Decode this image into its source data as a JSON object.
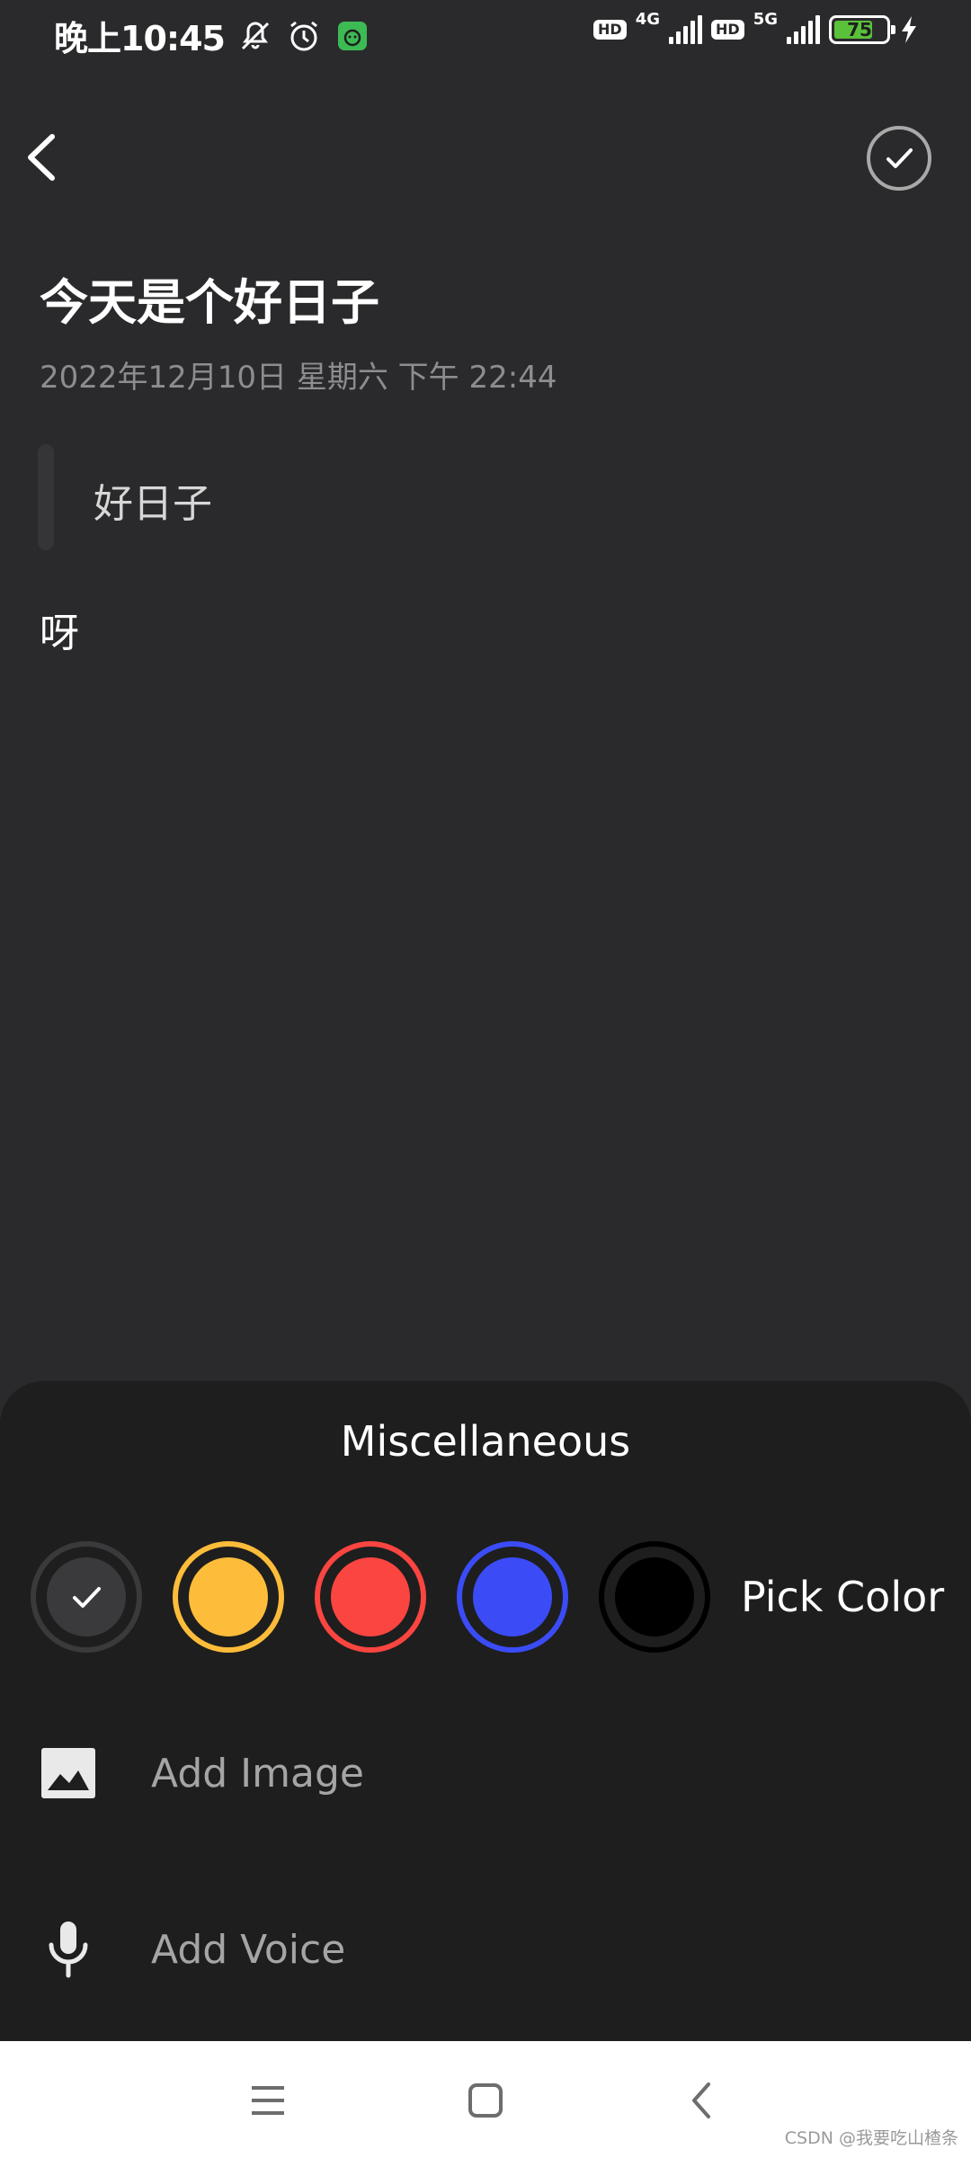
{
  "status_bar": {
    "time": "晚上10:45",
    "hd1": "HD",
    "net1": "4G",
    "hd2": "HD",
    "net2": "5G",
    "battery": "75",
    "battery_level": 0.75
  },
  "note": {
    "title": "今天是个好日子",
    "date": "2022年12月10日 星期六 下午 22:44",
    "quote": "好日子",
    "body": "呀"
  },
  "sheet": {
    "title": "Miscellaneous",
    "colors": [
      {
        "name": "default",
        "hex": "#2f2f31",
        "ring": "#2f2f31",
        "selected": true
      },
      {
        "name": "yellow",
        "hex": "#fdbc3a",
        "ring": "#fdbc3a",
        "selected": false
      },
      {
        "name": "red",
        "hex": "#fa4540",
        "ring": "#fa4540",
        "selected": false
      },
      {
        "name": "blue",
        "hex": "#3b4cf7",
        "ring": "#3b4cf7",
        "selected": false
      },
      {
        "name": "black",
        "hex": "#000000",
        "ring": "#000000",
        "selected": false
      }
    ],
    "pick_color": "Pick Color",
    "add_image": "Add Image",
    "add_voice": "Add Voice"
  },
  "icons": {
    "back": "chevron-left-icon",
    "done": "check-circle-icon",
    "image": "image-icon",
    "voice": "microphone-icon"
  },
  "watermark": "CSDN @我要吃山楂条"
}
